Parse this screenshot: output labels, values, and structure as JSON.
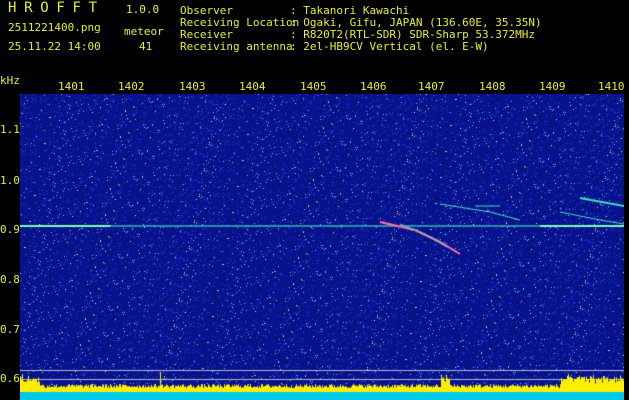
{
  "header": {
    "app_title": "HROFFT",
    "app_version": "1.0.0",
    "filename": "2511221400.png",
    "meteor_label": "meteor",
    "datetime": "25.11.22 14:00",
    "meteor_count": "41",
    "info": [
      {
        "label": "Observer",
        "value": ": Takanori Kawachi"
      },
      {
        "label": "Receiving Location",
        "value": ": Ogaki, Gifu, JAPAN (136.60E, 35.35N)"
      },
      {
        "label": "Receiver",
        "value": ": R820T2(RTL-SDR) SDR-Sharp 53.372MHz"
      },
      {
        "label": "Receiving antenna",
        "value": ": 2el-HB9CV Vertical (el. E-W)"
      }
    ]
  },
  "axes": {
    "y_unit": "kHz",
    "x_ticks": [
      "1401",
      "1402",
      "1403",
      "1404",
      "1405",
      "1406",
      "1407",
      "1408",
      "1409",
      "1410"
    ],
    "y_ticks": [
      "1.1",
      "1.0",
      "0.9",
      "0.8",
      "0.7",
      "0.6"
    ]
  },
  "colors": {
    "text": "#e8ee30",
    "background": "#000000",
    "noise_dark": "#08128a",
    "noise_bright": "#1030d0",
    "level_fill": "#ffee00",
    "floor": "#00c8e8",
    "signal": "#40e0c0",
    "signal_hot": "#ff70a0"
  }
}
